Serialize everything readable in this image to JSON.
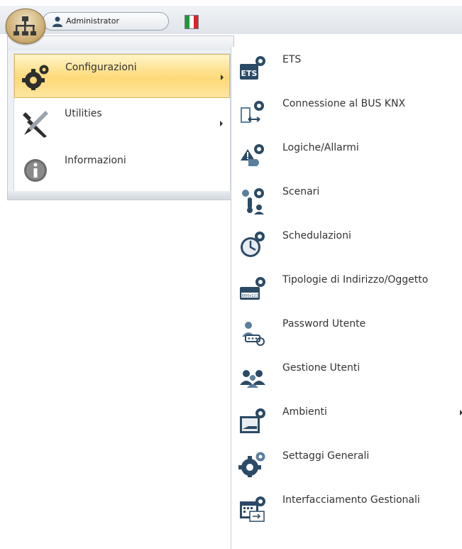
{
  "header": {
    "user_name": "Administrator",
    "flag_colors": [
      "#1a9b3a",
      "#ffffff",
      "#d9242b"
    ],
    "app_icon": "building-network-icon",
    "user_icon": "user-icon"
  },
  "main_menu": {
    "items": [
      {
        "label": "Configurazioni",
        "icon": "gears-icon",
        "has_submenu": true,
        "selected": true
      },
      {
        "label": "Utilities",
        "icon": "tools-icon",
        "has_submenu": true,
        "selected": false
      },
      {
        "label": "Informazioni",
        "icon": "info-icon",
        "has_submenu": false,
        "selected": false
      }
    ]
  },
  "submenu": {
    "items": [
      {
        "label": "ETS",
        "icon": "ets-gear-icon"
      },
      {
        "label": "Connessione al BUS KNX",
        "icon": "bus-connection-gear-icon"
      },
      {
        "label": "Logiche/Allarmi",
        "icon": "logic-alarm-gear-icon"
      },
      {
        "label": "Scenari",
        "icon": "scenes-gear-icon"
      },
      {
        "label": "Schedulazioni",
        "icon": "clock-gear-icon"
      },
      {
        "label": "Tipologie di Indirizzo/Oggetto",
        "icon": "address-type-gear-icon",
        "badge": "0000x123'"
      },
      {
        "label": "Password Utente",
        "icon": "user-password-icon"
      },
      {
        "label": "Gestione Utenti",
        "icon": "users-management-icon"
      },
      {
        "label": "Ambienti",
        "icon": "room-gear-icon",
        "has_submenu": true
      },
      {
        "label": "Settaggi Generali",
        "icon": "general-settings-gear-icon"
      },
      {
        "label": "Interfacciamento Gestionali",
        "icon": "calendar-interface-gear-icon"
      }
    ]
  },
  "colors": {
    "accent_highlight": "#fed977",
    "icon_dark": "#2b4a66",
    "icon_mid": "#5c7f9e"
  }
}
